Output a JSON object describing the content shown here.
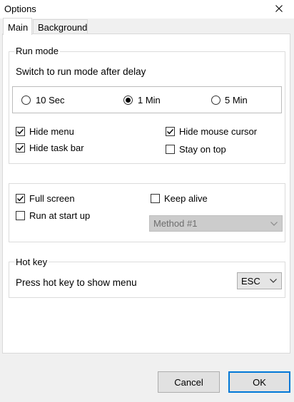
{
  "window": {
    "title": "Options"
  },
  "tabs": [
    {
      "label": "Main",
      "active": true
    },
    {
      "label": "Background",
      "active": false
    }
  ],
  "run_mode": {
    "title": "Run mode",
    "description": "Switch to run mode after delay",
    "delays": [
      {
        "label": "10 Sec",
        "selected": false
      },
      {
        "label": "1 Min",
        "selected": true
      },
      {
        "label": "5 Min",
        "selected": false
      }
    ],
    "options": {
      "hide_menu": {
        "label": "Hide menu",
        "checked": true
      },
      "hide_mouse_cursor": {
        "label": "Hide mouse cursor",
        "checked": true
      },
      "hide_task_bar": {
        "label": "Hide task bar",
        "checked": true
      },
      "stay_on_top": {
        "label": "Stay on top",
        "checked": false
      }
    }
  },
  "display": {
    "full_screen": {
      "label": "Full screen",
      "checked": true
    },
    "keep_alive": {
      "label": "Keep alive",
      "checked": false
    },
    "run_at_start_up": {
      "label": "Run at start up",
      "checked": false
    },
    "method_select": {
      "value": "Method #1",
      "disabled": true
    }
  },
  "hot_key": {
    "title": "Hot key",
    "description": "Press hot key to show menu",
    "key_select": {
      "value": "ESC"
    }
  },
  "footer": {
    "cancel_label": "Cancel",
    "ok_label": "OK"
  },
  "colors": {
    "accent": "#0078d7",
    "window_bg": "#f0f0f0",
    "panel_bg": "#ffffff"
  }
}
